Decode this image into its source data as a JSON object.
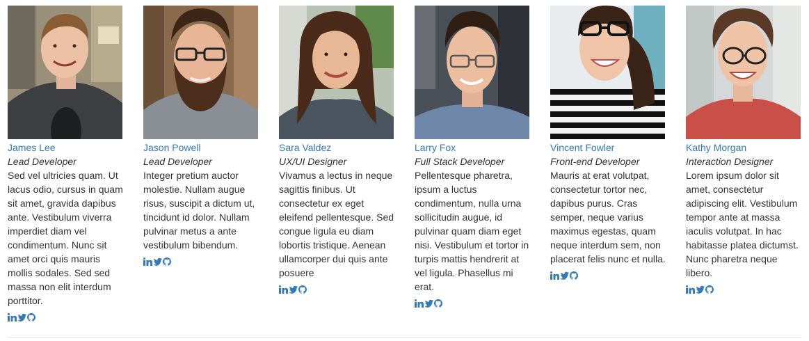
{
  "members": [
    {
      "name": "James Lee",
      "role": "Lead Developer",
      "bio": "Sed vel ultricies quam. Ut lacus odio, cursus in quam sit amet, gravida dapibus ante. Vestibulum viverra imperdiet diam vel condimentum. Nunc sit amet orci quis mauris mollis sodales. Sed sed massa non elit interdum porttitor."
    },
    {
      "name": "Jason Powell",
      "role": "Lead Developer",
      "bio": "Integer pretium auctor molestie. Nullam augue risus, suscipit a dictum ut, tincidunt id dolor. Nullam pulvinar metus a ante vestibulum bibendum."
    },
    {
      "name": "Sara Valdez",
      "role": "UX/UI Designer",
      "bio": "Vivamus a lectus in neque sagittis finibus. Ut consectetur ex eget eleifend pellentesque. Sed congue ligula eu diam lobortis tristique. Aenean ullamcorper dui quis ante posuere"
    },
    {
      "name": "Larry Fox",
      "role": "Full Stack Developer",
      "bio": "Pellentesque pharetra, ipsum a luctus condimentum, nulla urna sollicitudin augue, id pulvinar quam diam eget nisi. Vestibulum et tortor in turpis mattis hendrerit at vel ligula. Phasellus mi erat."
    },
    {
      "name": "Vincent Fowler",
      "role": "Front-end Developer",
      "bio": "Mauris at erat volutpat, consectetur tortor nec, dapibus purus. Cras semper, neque varius maximus egestas, quam neque interdum sem, non placerat felis nunc et nulla."
    },
    {
      "name": "Kathy Morgan",
      "role": "Interaction Designer",
      "bio": "Lorem ipsum dolor sit amet, consectetur adipiscing elit. Vestibulum tempor ante at massa iaculis volutpat. In hac habitasse platea dictumst. Nunc pharetra neque libero."
    }
  ],
  "social_icons": [
    "linkedin-icon",
    "twitter-icon",
    "github-icon"
  ],
  "colors": {
    "link": "#337ab7",
    "text": "#333333",
    "divider": "#e5e5e5"
  }
}
